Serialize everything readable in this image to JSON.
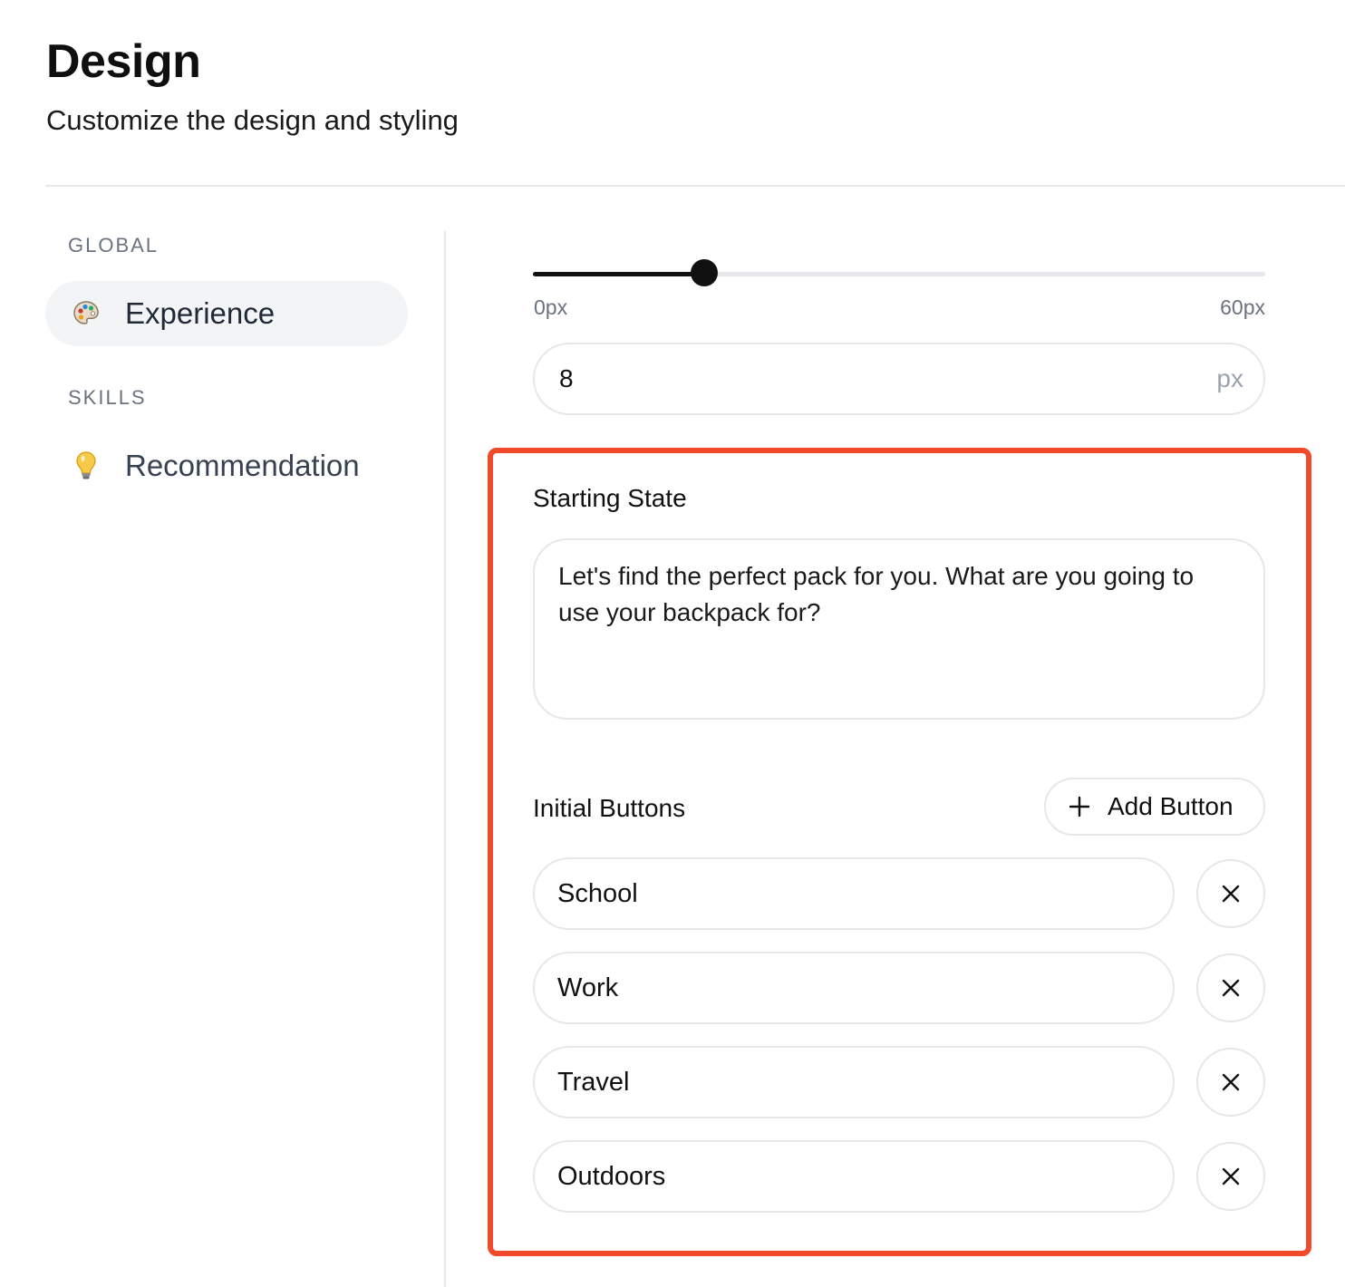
{
  "header": {
    "title": "Design",
    "subtitle": "Customize the design and styling"
  },
  "sidebar": {
    "sections": [
      {
        "label": "GLOBAL",
        "items": [
          {
            "label": "Experience",
            "icon": "palette-icon",
            "active": true
          }
        ]
      },
      {
        "label": "SKILLS",
        "items": [
          {
            "label": "Recommendation",
            "icon": "lightbulb-icon",
            "active": false
          }
        ]
      }
    ]
  },
  "main": {
    "slider": {
      "min_label": "0px",
      "max_label": "60px",
      "value": 8,
      "max": 60
    },
    "size_input": {
      "value": "8",
      "unit": "px"
    },
    "starting_state": {
      "label": "Starting State",
      "message": "Let's find the perfect pack for you. What are you going to use your backpack for?"
    },
    "initial_buttons": {
      "label": "Initial Buttons",
      "add_label": "Add Button",
      "options": [
        "School",
        "Work",
        "Travel",
        "Outdoors"
      ]
    }
  },
  "colors": {
    "highlight": "#f04a2a",
    "accent": "#111111",
    "border": "#e5e7eb",
    "nav_active_bg": "#f3f4f6"
  }
}
